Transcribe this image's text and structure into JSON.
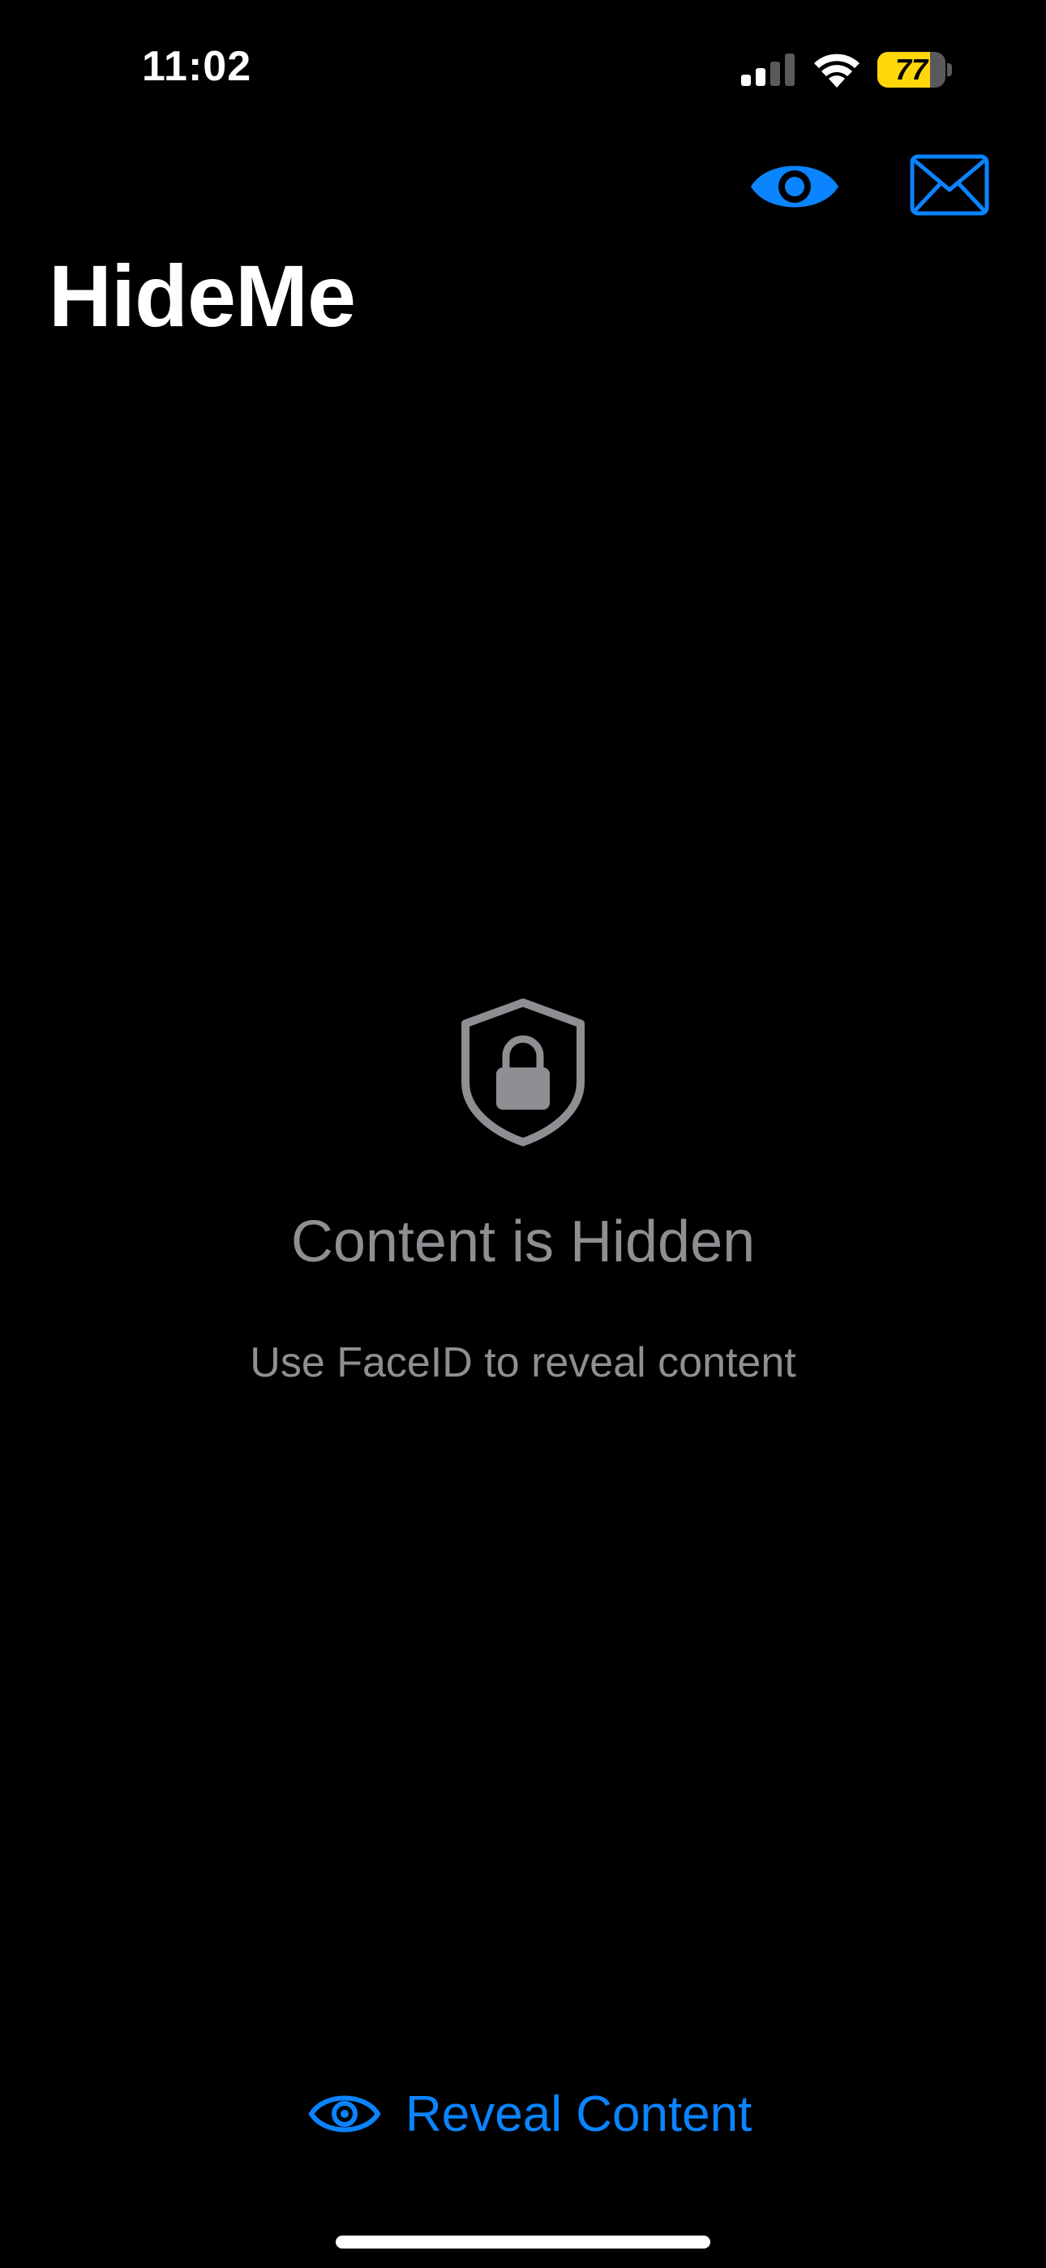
{
  "status_bar": {
    "time": "11:02",
    "battery_percent": "77",
    "battery_level": 0.77,
    "signal_bars_active": 2,
    "signal_bars_total": 4
  },
  "nav": {
    "title": "HideMe",
    "icons": [
      "eye-icon",
      "envelope-icon"
    ]
  },
  "empty_state": {
    "icon": "lock-shield-icon",
    "title": "Content is Hidden",
    "subtitle": "Use FaceID to reveal content"
  },
  "reveal": {
    "label": "Reveal Content",
    "icon": "eye-icon"
  },
  "colors": {
    "background": "#000000",
    "accent": "#0a84ff",
    "secondary_text": "#8e8e93",
    "battery": "#ffd60a"
  }
}
